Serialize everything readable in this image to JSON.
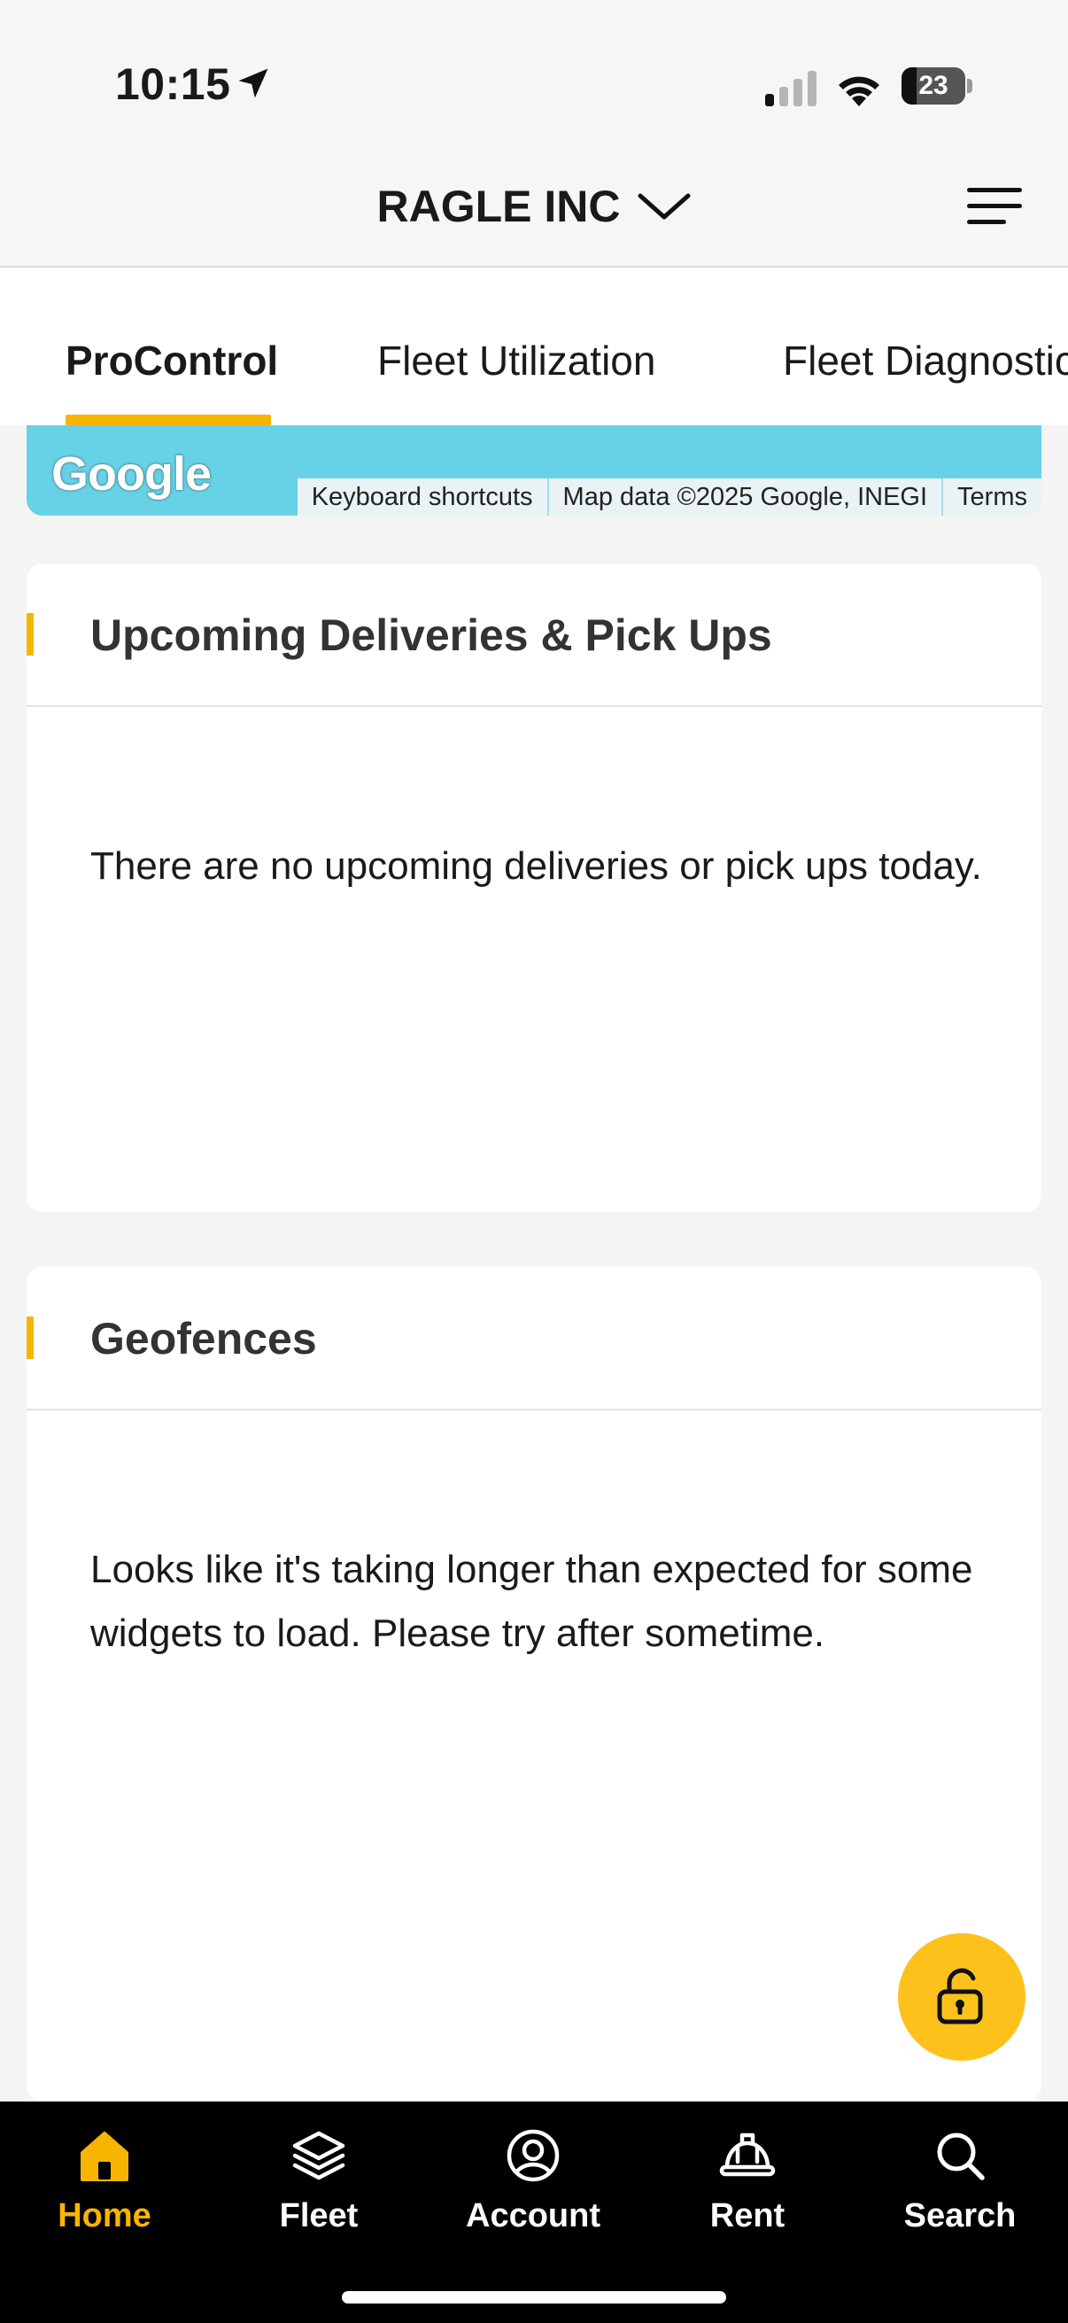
{
  "status_bar": {
    "time": "10:15",
    "battery": "23",
    "battery_level_percent": 23
  },
  "header": {
    "company": "RAGLE INC"
  },
  "tabs": [
    {
      "label": "ProControl",
      "active": true
    },
    {
      "label": "Fleet Utilization",
      "active": false
    },
    {
      "label": "Fleet Diagnostics",
      "active": false
    }
  ],
  "map": {
    "logo": "Google",
    "keyboard_shortcuts": "Keyboard shortcuts",
    "map_data": "Map data ©2025 Google, INEGI",
    "terms": "Terms"
  },
  "cards": {
    "deliveries": {
      "title": "Upcoming Deliveries & Pick Ups",
      "message": "There are no upcoming deliveries or pick ups today."
    },
    "geofences": {
      "title": "Geofences",
      "message": "Looks like it's taking longer than expected for some widgets to load. Please try after sometime."
    }
  },
  "bottom_nav": [
    {
      "label": "Home",
      "icon": "home-icon",
      "active": true
    },
    {
      "label": "Fleet",
      "icon": "layers-icon",
      "active": false
    },
    {
      "label": "Account",
      "icon": "account-icon",
      "active": false
    },
    {
      "label": "Rent",
      "icon": "hard-hat-icon",
      "active": false
    },
    {
      "label": "Search",
      "icon": "search-icon",
      "active": false
    }
  ],
  "colors": {
    "accent": "#f7b500",
    "fab": "#fcc21b",
    "map_water": "#67d1e6",
    "nav_background": "#000000"
  }
}
